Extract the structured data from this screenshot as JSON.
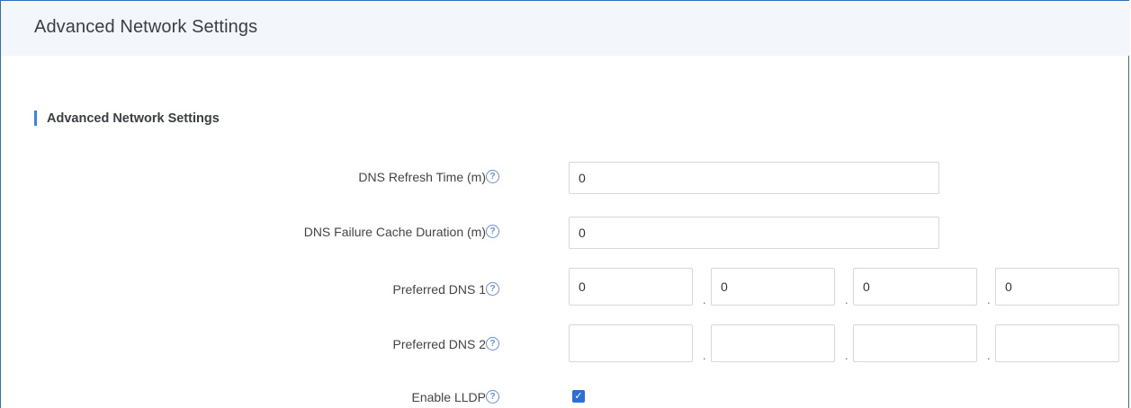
{
  "header": {
    "title": "Advanced Network Settings"
  },
  "section": {
    "title": "Advanced Network Settings"
  },
  "help_icon_glyph": "?",
  "fields": {
    "dns_refresh_time": {
      "label": "DNS Refresh Time (m)",
      "value": "0"
    },
    "dns_failure_cache": {
      "label": "DNS Failure Cache Duration (m)",
      "value": "0"
    },
    "preferred_dns_1": {
      "label": "Preferred DNS 1",
      "octets": [
        "0",
        "0",
        "0",
        "0"
      ]
    },
    "preferred_dns_2": {
      "label": "Preferred DNS 2",
      "octets": [
        "",
        "",
        "",
        ""
      ]
    },
    "enable_lldp": {
      "label": "Enable LLDP",
      "checked": true,
      "check_glyph": "✓"
    }
  },
  "separator": ".",
  "colors": {
    "accent": "#3b82f6",
    "header_bg": "#f3f6fa",
    "checkbox": "#2d6fd6"
  }
}
